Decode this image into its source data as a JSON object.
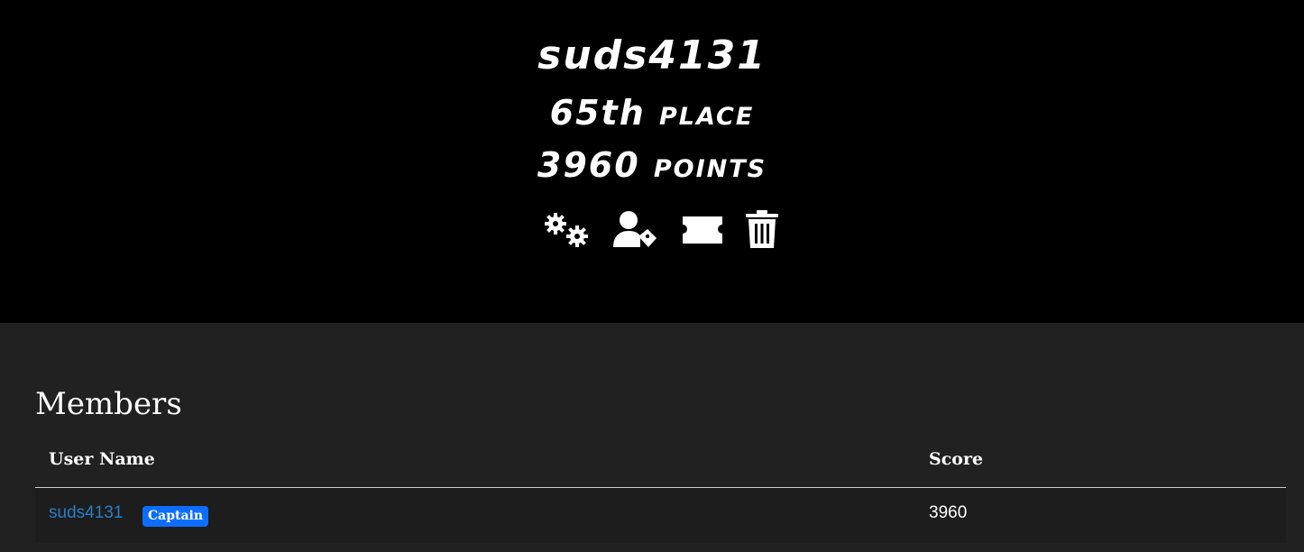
{
  "team": {
    "name": "suds4131",
    "place_number": "65th",
    "place_word": "place",
    "points_number": "3960",
    "points_word": "points"
  },
  "actions": [
    {
      "icon": "gears-icon"
    },
    {
      "icon": "user-tag-icon"
    },
    {
      "icon": "ticket-icon"
    },
    {
      "icon": "trash-icon"
    }
  ],
  "members": {
    "title": "Members",
    "columns": [
      "User Name",
      "Score"
    ],
    "rows": [
      {
        "user": "suds4131",
        "badge": "Captain",
        "score": "3960"
      }
    ]
  },
  "colors": {
    "hero_bg": "#000000",
    "page_bg": "#212121",
    "link": "#2a7ec7",
    "badge": "#0d6efd"
  }
}
